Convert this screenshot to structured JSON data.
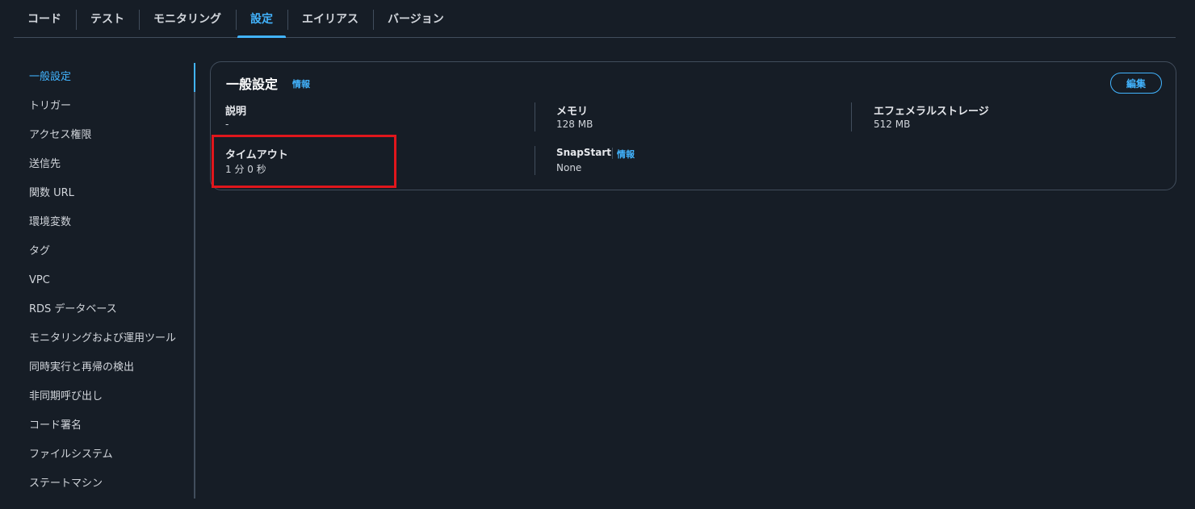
{
  "tabs": [
    {
      "label": "コード"
    },
    {
      "label": "テスト"
    },
    {
      "label": "モニタリング"
    },
    {
      "label": "設定"
    },
    {
      "label": "エイリアス"
    },
    {
      "label": "バージョン"
    }
  ],
  "sidenav": {
    "items": [
      {
        "label": "一般設定"
      },
      {
        "label": "トリガー"
      },
      {
        "label": "アクセス権限"
      },
      {
        "label": "送信先"
      },
      {
        "label": "関数 URL"
      },
      {
        "label": "環境変数"
      },
      {
        "label": "タグ"
      },
      {
        "label": "VPC"
      },
      {
        "label": "RDS データベース"
      },
      {
        "label": "モニタリングおよび運用ツール"
      },
      {
        "label": "同時実行と再帰の検出"
      },
      {
        "label": "非同期呼び出し"
      },
      {
        "label": "コード署名"
      },
      {
        "label": "ファイルシステム"
      },
      {
        "label": "ステートマシン"
      }
    ]
  },
  "card": {
    "title": "一般設定",
    "info_label": "情報",
    "edit_label": "編集",
    "fields": {
      "description": {
        "label": "説明",
        "value": "-"
      },
      "memory": {
        "label": "メモリ",
        "value": "128  MB"
      },
      "ephemeral": {
        "label": "エフェメラルストレージ",
        "value": "512  MB"
      },
      "timeout": {
        "label": "タイムアウト",
        "value": "1 分  0 秒"
      },
      "snapstart": {
        "label": "SnapStart",
        "info_label": "情報",
        "value": "None"
      }
    }
  },
  "colors": {
    "background": "#161d26",
    "accent": "#42b4ff",
    "border": "#414d5c",
    "highlight": "#e0161c"
  }
}
